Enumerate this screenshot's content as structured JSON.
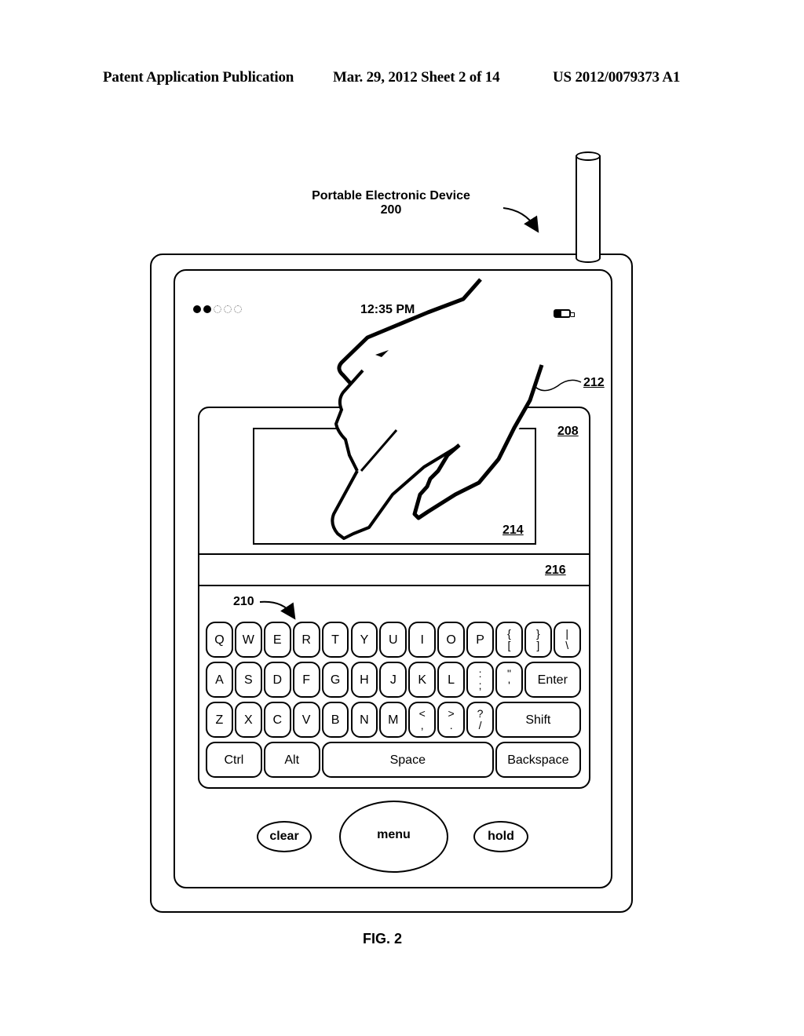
{
  "header": {
    "left": "Patent Application Publication",
    "center": "Mar. 29, 2012  Sheet 2 of 14",
    "right": "US 2012/0079373 A1"
  },
  "device_label": {
    "title": "Portable Electronic Device",
    "number": "200"
  },
  "status_bar": {
    "signal_filled": 2,
    "signal_total": 5,
    "time": "12:35 PM",
    "battery_icon": "battery-icon",
    "battery_level": 0.45
  },
  "references": {
    "hand": "212",
    "display_panel": "208",
    "display_region": "214",
    "text_field": "216",
    "keyboard": "210"
  },
  "keyboard": {
    "rows": [
      [
        {
          "label": "Q"
        },
        {
          "label": "W"
        },
        {
          "label": "E"
        },
        {
          "label": "R"
        },
        {
          "label": "T"
        },
        {
          "label": "Y"
        },
        {
          "label": "U"
        },
        {
          "label": "I"
        },
        {
          "label": "O"
        },
        {
          "label": "P"
        },
        {
          "top": "{",
          "bottom": "["
        },
        {
          "top": "}",
          "bottom": "]"
        },
        {
          "top": "|",
          "bottom": "\\"
        }
      ],
      [
        {
          "label": "A"
        },
        {
          "label": "S"
        },
        {
          "label": "D"
        },
        {
          "label": "F"
        },
        {
          "label": "G"
        },
        {
          "label": "H"
        },
        {
          "label": "J"
        },
        {
          "label": "K"
        },
        {
          "label": "L"
        },
        {
          "top": ":",
          "bottom": ";"
        },
        {
          "top": "\"",
          "bottom": "'"
        },
        {
          "label": "Enter",
          "wide": 2
        }
      ],
      [
        {
          "label": "Z"
        },
        {
          "label": "X"
        },
        {
          "label": "C"
        },
        {
          "label": "V"
        },
        {
          "label": "B"
        },
        {
          "label": "N"
        },
        {
          "label": "M"
        },
        {
          "top": "<",
          "bottom": ","
        },
        {
          "top": ">",
          "bottom": "."
        },
        {
          "top": "?",
          "bottom": "/"
        },
        {
          "label": "Shift",
          "wide": 3
        }
      ],
      [
        {
          "label": "Ctrl",
          "wide": 2
        },
        {
          "label": "Alt",
          "wide": 2
        },
        {
          "label": "Space",
          "wide": 6
        },
        {
          "label": "Backspace",
          "wide": 3
        }
      ]
    ]
  },
  "buttons": {
    "clear": "clear",
    "menu": "menu",
    "hold": "hold"
  },
  "figure_caption": "FIG. 2"
}
